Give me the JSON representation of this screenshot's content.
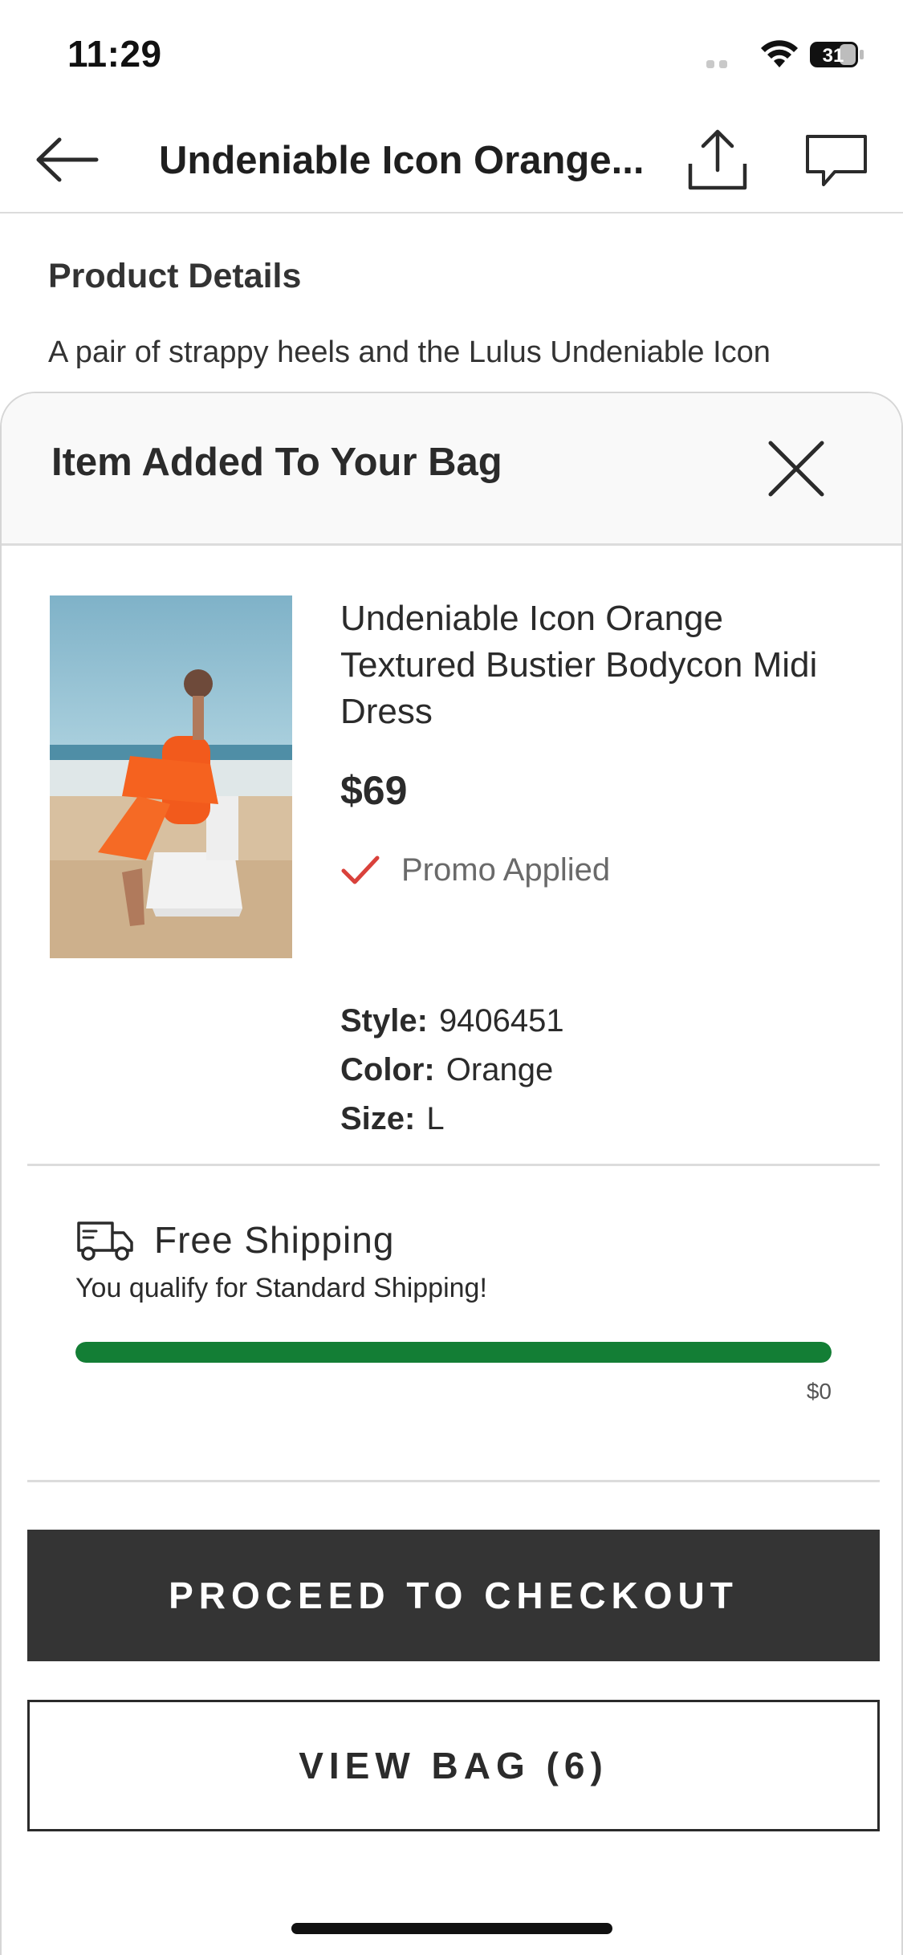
{
  "status_bar": {
    "time": "11:29",
    "battery": "31"
  },
  "nav": {
    "title": "Undeniable Icon Orange..."
  },
  "background": {
    "heading": "Product Details",
    "text": "A pair of strappy heels and the Lulus Undeniable Icon"
  },
  "sheet": {
    "title": "Item Added To Your Bag",
    "product": {
      "name": "Undeniable Icon Orange Textured Bustier Bodycon Midi Dress",
      "price": "$69",
      "promo": "Promo Applied",
      "attributes": [
        {
          "label": "Style:",
          "value": "9406451"
        },
        {
          "label": "Color:",
          "value": "Orange"
        },
        {
          "label": "Size:",
          "value": "L"
        }
      ]
    },
    "shipping": {
      "title": "Free Shipping",
      "subtitle": "You qualify for Standard Shipping!",
      "progress_percent": 100,
      "remaining": "$0"
    },
    "checkout_label": "PROCEED TO CHECKOUT",
    "view_bag_label": "VIEW BAG (6)"
  },
  "colors": {
    "progress_fill": "#137e35",
    "promo_check": "#d9413b",
    "checkout_bg": "#343434"
  }
}
